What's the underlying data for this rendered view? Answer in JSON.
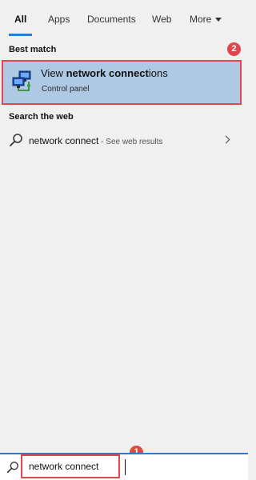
{
  "tabs": [
    {
      "label": "All",
      "active": true
    },
    {
      "label": "Apps",
      "active": false
    },
    {
      "label": "Documents",
      "active": false
    },
    {
      "label": "Web",
      "active": false
    },
    {
      "label": "More",
      "active": false
    }
  ],
  "best_match": {
    "section_title": "Best match",
    "title_prefix": "View ",
    "title_bold": "network connect",
    "title_suffix": "ions",
    "subtitle": "Control panel",
    "badge": "2",
    "icon": "network-connections-icon"
  },
  "web": {
    "section_title": "Search the web",
    "query": "network connect",
    "suffix": " - See web results"
  },
  "search": {
    "value": "network connect",
    "badge": "1",
    "icon": "search-icon"
  },
  "colors": {
    "accent": "#2b7bd5",
    "annotation_red": "#e0474c",
    "selection_bg": "#aec9e3",
    "panel_bg": "#f0f0f0"
  }
}
